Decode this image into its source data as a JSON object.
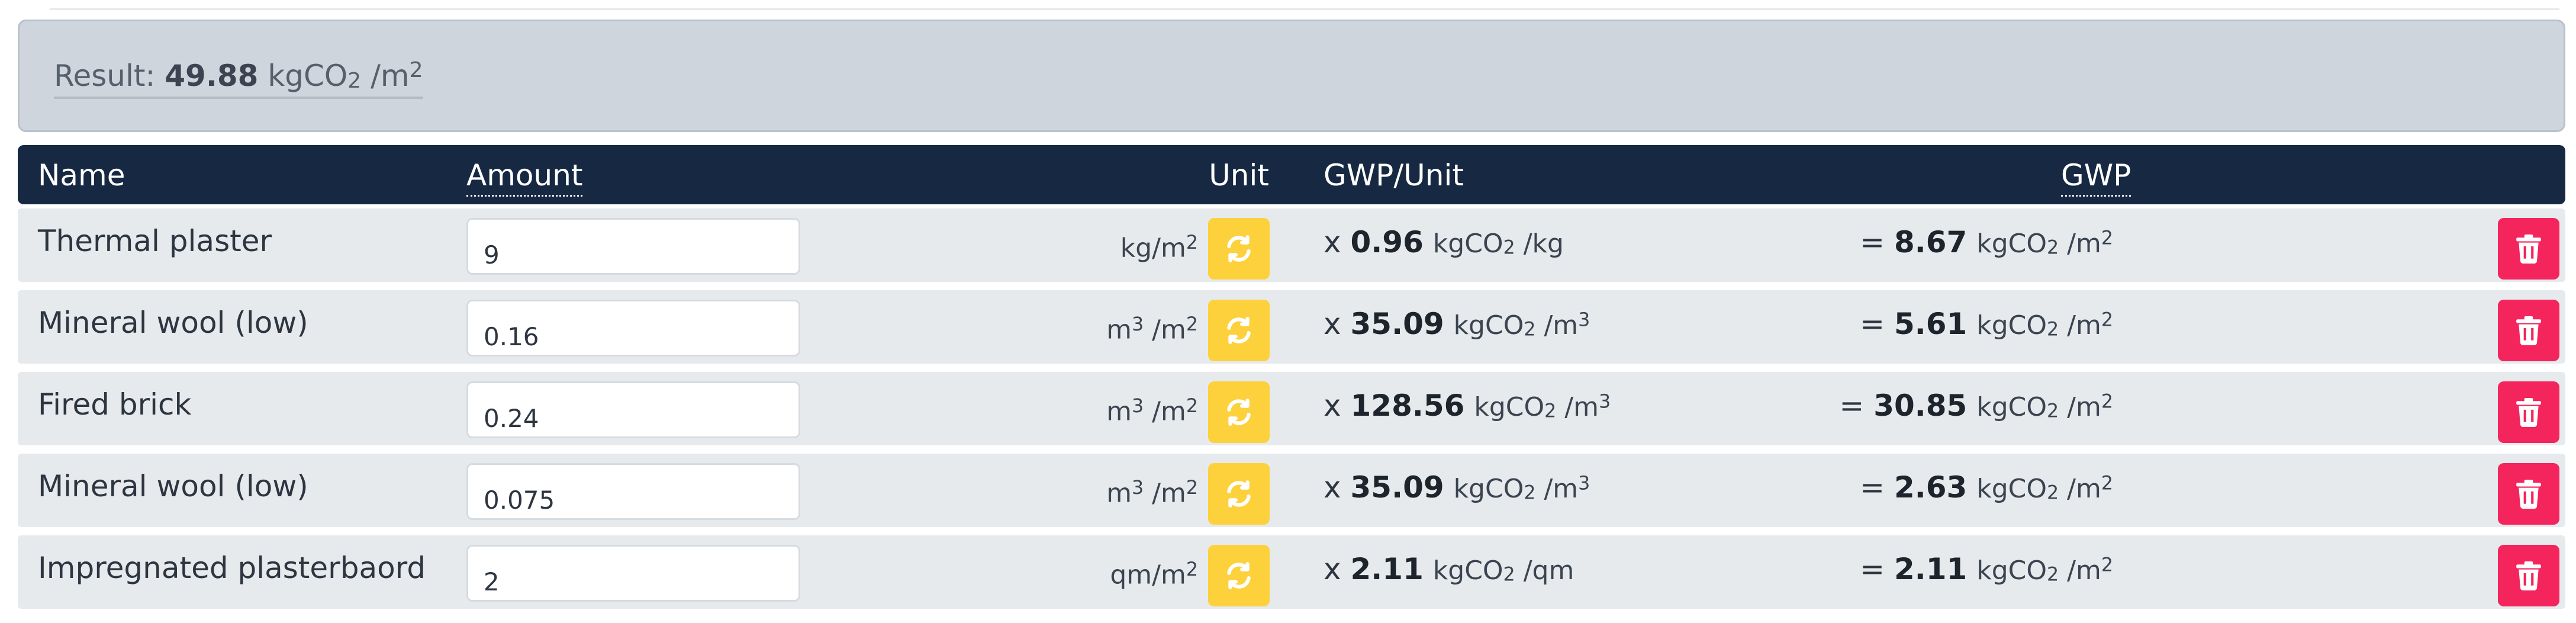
{
  "result": {
    "label": "Result:",
    "value": "49.88",
    "unit_prefix": "kgCO",
    "unit_sub": "2",
    "unit_mid": " /m",
    "unit_sup": "2"
  },
  "table": {
    "headers": {
      "name": "Name",
      "amount": "Amount",
      "unit": "Unit",
      "gwp_per_unit": "GWP/Unit",
      "gwp": "GWP"
    },
    "rows": [
      {
        "name": "Thermal plaster",
        "amount": "9",
        "unit_a": "kg/m",
        "unit_a_sup": "2",
        "unit_b": "",
        "unit_b_sup": "",
        "gwpu_prefix": "x",
        "gwpu_value": "0.96",
        "gwpu_unit": "kgCO",
        "gwpu_unit_sub": "2",
        "gwpu_unit_tail": " /kg",
        "gwpu_unit_sup": "",
        "gwp_prefix": "=",
        "gwp_value": "8.67",
        "gwp_unit": "kgCO",
        "gwp_unit_sub": "2",
        "gwp_unit_tail": " /m",
        "gwp_unit_sup": "2"
      },
      {
        "name": "Mineral wool (low)",
        "amount": "0.16",
        "unit_a": "m",
        "unit_a_sup": "3",
        "unit_b": " /m",
        "unit_b_sup": "2",
        "gwpu_prefix": "x",
        "gwpu_value": "35.09",
        "gwpu_unit": "kgCO",
        "gwpu_unit_sub": "2",
        "gwpu_unit_tail": " /m",
        "gwpu_unit_sup": "3",
        "gwp_prefix": "=",
        "gwp_value": "5.61",
        "gwp_unit": "kgCO",
        "gwp_unit_sub": "2",
        "gwp_unit_tail": " /m",
        "gwp_unit_sup": "2"
      },
      {
        "name": "Fired brick",
        "amount": "0.24",
        "unit_a": "m",
        "unit_a_sup": "3",
        "unit_b": " /m",
        "unit_b_sup": "2",
        "gwpu_prefix": "x",
        "gwpu_value": "128.56",
        "gwpu_unit": "kgCO",
        "gwpu_unit_sub": "2",
        "gwpu_unit_tail": " /m",
        "gwpu_unit_sup": "3",
        "gwp_prefix": "=",
        "gwp_value": "30.85",
        "gwp_unit": "kgCO",
        "gwp_unit_sub": "2",
        "gwp_unit_tail": " /m",
        "gwp_unit_sup": "2"
      },
      {
        "name": "Mineral wool (low)",
        "amount": "0.075",
        "unit_a": "m",
        "unit_a_sup": "3",
        "unit_b": " /m",
        "unit_b_sup": "2",
        "gwpu_prefix": "x",
        "gwpu_value": "35.09",
        "gwpu_unit": "kgCO",
        "gwpu_unit_sub": "2",
        "gwpu_unit_tail": " /m",
        "gwpu_unit_sup": "3",
        "gwp_prefix": "=",
        "gwp_value": "2.63",
        "gwp_unit": "kgCO",
        "gwp_unit_sub": "2",
        "gwp_unit_tail": " /m",
        "gwp_unit_sup": "2"
      },
      {
        "name": "Impregnated plasterbaord",
        "amount": "2",
        "unit_a": "qm/m",
        "unit_a_sup": "2",
        "unit_b": "",
        "unit_b_sup": "",
        "gwpu_prefix": "x",
        "gwpu_value": "2.11",
        "gwpu_unit": "kgCO",
        "gwpu_unit_sub": "2",
        "gwpu_unit_tail": " /qm",
        "gwpu_unit_sup": "",
        "gwp_prefix": "=",
        "gwp_value": "2.11",
        "gwp_unit": "kgCO",
        "gwp_unit_sub": "2",
        "gwp_unit_tail": " /m",
        "gwp_unit_sup": "2"
      }
    ]
  },
  "icons": {
    "swap": "refresh-icon",
    "delete": "trash-icon"
  },
  "colors": {
    "header_bg": "#172942",
    "result_bg": "#ced5dd",
    "row_bg": "#e7eaed",
    "swap_button": "#fdd13b",
    "delete_button": "#f4245c"
  }
}
